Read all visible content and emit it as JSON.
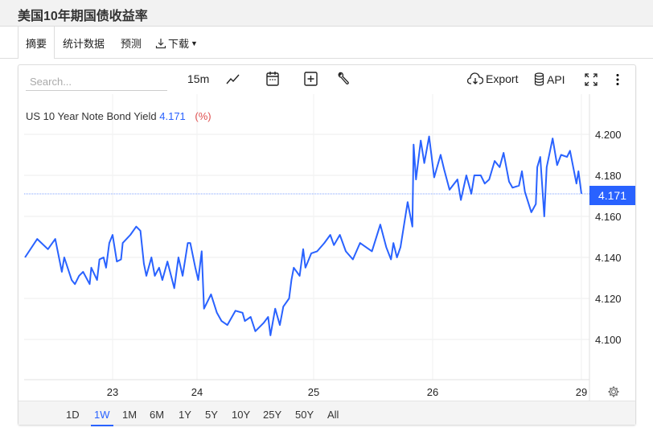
{
  "title": "美国10年期国债收益率",
  "tabs": [
    {
      "label": "摘要",
      "active": true
    },
    {
      "label": "统计数据"
    },
    {
      "label": "预测"
    },
    {
      "label": "下载"
    }
  ],
  "toolbar": {
    "search_placeholder": "Search...",
    "interval": "15m",
    "export_label": "Export",
    "api_label": "API"
  },
  "legend": {
    "name": "US 10 Year Note Bond Yield",
    "value": "4.171",
    "unit": "(%)"
  },
  "ranges": [
    {
      "label": "1D"
    },
    {
      "label": "1W",
      "active": true
    },
    {
      "label": "1M"
    },
    {
      "label": "6M"
    },
    {
      "label": "1Y"
    },
    {
      "label": "5Y"
    },
    {
      "label": "10Y"
    },
    {
      "label": "25Y"
    },
    {
      "label": "50Y"
    },
    {
      "label": "All"
    }
  ],
  "colors": {
    "line": "#2962ff",
    "accent": "#2962ff",
    "unit": "#e05050"
  },
  "chart_data": {
    "type": "line",
    "title": "US 10 Year Note Bond Yield",
    "xlabel": "",
    "ylabel": "(%)",
    "ylim": [
      4.085,
      4.212
    ],
    "yticks": [
      "4.100",
      "4.120",
      "4.140",
      "4.160",
      "4.180",
      "4.200"
    ],
    "xticks": [
      {
        "day": 23,
        "label": "23"
      },
      {
        "day": 24,
        "label": "24"
      },
      {
        "day": 25,
        "label": "25"
      },
      {
        "day": 26,
        "label": "26"
      },
      {
        "day": 29,
        "label": "29"
      }
    ],
    "last_value": "4.171",
    "grid": true,
    "series": [
      {
        "name": "US 10 Year Note Bond Yield",
        "x": [
          21.93,
          22.08,
          22.21,
          22.3,
          22.38,
          22.41,
          22.5,
          22.54,
          22.59,
          22.64,
          22.72,
          22.74,
          22.81,
          22.84,
          22.89,
          22.92,
          22.96,
          23.0,
          23.05,
          23.1,
          23.12,
          23.21,
          23.28,
          23.33,
          23.37,
          23.4,
          23.46,
          23.5,
          23.55,
          23.59,
          23.65,
          23.73,
          23.78,
          23.83,
          23.89,
          23.92,
          23.98,
          24.01,
          24.04,
          24.06,
          24.12,
          24.17,
          24.21,
          24.26,
          24.33,
          24.39,
          24.41,
          24.46,
          24.5,
          24.57,
          24.61,
          24.63,
          24.67,
          24.71,
          24.74,
          24.79,
          24.81,
          24.83,
          24.88,
          24.91,
          24.93,
          24.98,
          25.03,
          25.09,
          25.14,
          25.17,
          25.22,
          25.27,
          25.33,
          25.39,
          25.49,
          25.56,
          25.61,
          25.65,
          25.67,
          25.7,
          25.73,
          25.79,
          25.83,
          25.84,
          25.86,
          25.9,
          25.93,
          25.97,
          26.03,
          26.16,
          26.23,
          26.34,
          26.5,
          26.57,
          26.68,
          26.78,
          26.84,
          26.97,
          27.05,
          27.14,
          27.25,
          27.35,
          27.43,
          27.54,
          27.61,
          27.74,
          27.8,
          27.86,
          27.99,
          28.08,
          28.11,
          28.17,
          28.25,
          28.3,
          28.42,
          28.51,
          28.59,
          28.71,
          28.77,
          28.9,
          28.94,
          29.0
        ],
        "values": [
          4.14,
          4.149,
          4.144,
          4.149,
          4.133,
          4.14,
          4.129,
          4.127,
          4.131,
          4.133,
          4.127,
          4.135,
          4.129,
          4.139,
          4.14,
          4.135,
          4.147,
          4.151,
          4.138,
          4.139,
          4.147,
          4.151,
          4.155,
          4.153,
          4.137,
          4.131,
          4.14,
          4.131,
          4.135,
          4.129,
          4.138,
          4.125,
          4.14,
          4.131,
          4.147,
          4.147,
          4.135,
          4.129,
          4.143,
          4.115,
          4.122,
          4.113,
          4.109,
          4.107,
          4.114,
          4.113,
          4.109,
          4.111,
          4.104,
          4.108,
          4.111,
          4.102,
          4.115,
          4.107,
          4.116,
          4.12,
          4.129,
          4.135,
          4.131,
          4.144,
          4.135,
          4.142,
          4.143,
          4.147,
          4.151,
          4.146,
          4.151,
          4.143,
          4.139,
          4.147,
          4.143,
          4.156,
          4.145,
          4.139,
          4.147,
          4.14,
          4.145,
          4.167,
          4.155,
          4.195,
          4.178,
          4.197,
          4.186,
          4.199,
          4.179,
          4.19,
          4.183,
          4.173,
          4.178,
          4.168,
          4.18,
          4.171,
          4.18,
          4.18,
          4.176,
          4.178,
          4.187,
          4.184,
          4.191,
          4.177,
          4.174,
          4.175,
          4.182,
          4.172,
          4.162,
          4.166,
          4.184,
          4.189,
          4.16,
          4.184,
          4.198,
          4.185,
          4.19,
          4.189,
          4.192,
          4.176,
          4.182,
          4.171
        ]
      }
    ]
  }
}
